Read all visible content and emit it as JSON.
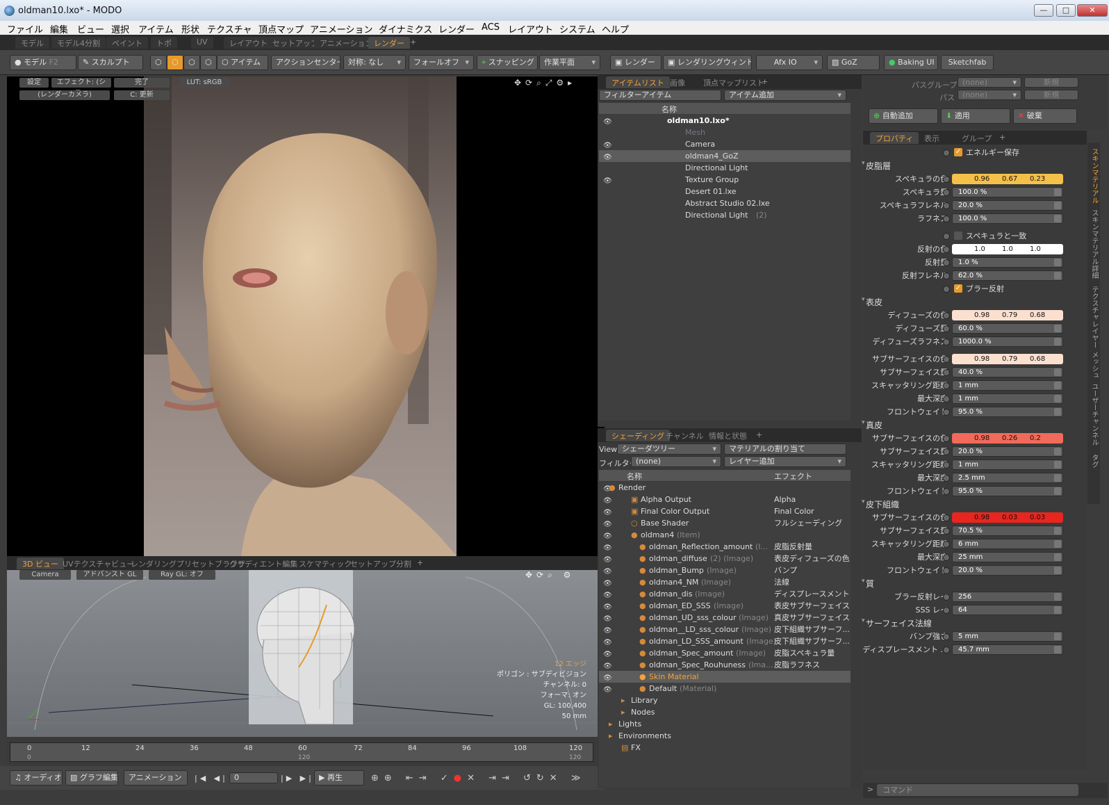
{
  "window": {
    "title": "oldman10.lxo* - MODO"
  },
  "menu": [
    "ファイル",
    "編集",
    "ビュー",
    "選択",
    "アイテム",
    "形状",
    "テクスチャ",
    "頂点マップ",
    "アニメーション",
    "ダイナミクス",
    "レンダー",
    "ACS",
    "レイアウト",
    "システム",
    "ヘルプ"
  ],
  "layout_tabs": [
    "モデル",
    "モデル4分割",
    "ペイント",
    "トポ",
    "UV",
    "レイアウト",
    "セットアップ",
    "アニメーション",
    "レンダー"
  ],
  "toolbar": {
    "model": "モデル",
    "f2": "F2",
    "sculpt": "スカルプト",
    "item": "アイテム",
    "action_center": "アクションセンター",
    "symmetry": "対称: なし",
    "falloff": "フォールオフ",
    "snapping": "スナッピング",
    "work_plane": "作業平面",
    "render": "レンダー",
    "render_window": "レンダリングウィンドウ",
    "afx": "Afx IO",
    "goz": "GoZ",
    "baking": "Baking UI",
    "sketchfab": "Sketchfab"
  },
  "viewport": {
    "settings": "設定",
    "effect": "エフェクト: (シェ...",
    "done": "完了",
    "lut": "LUT: sRGB",
    "camera": "(レンダーカメラ)",
    "update": "C: 更新"
  },
  "bottom_tabs": [
    "3D ビュー",
    "UVテクスチャビュー",
    "レンダリングプリセットブラウザ",
    "グラディエント編集",
    "スケマティック",
    "セットアップ分割"
  ],
  "gl": {
    "camera": "Camera",
    "advanced": "アドバンスト GL",
    "raygl": "Ray GL: オフ",
    "info": [
      "12 エッジ",
      "ポリゴン : サブディビジョン",
      "チャンネル: 0",
      "フォーマ: オン",
      "GL: 100,400",
      "50 mm"
    ]
  },
  "timeline": {
    "ticks": [
      "0",
      "12",
      "24",
      "36",
      "48",
      "60",
      "72",
      "84",
      "96",
      "108",
      "120"
    ],
    "start": "0",
    "mid": "120",
    "end": "120"
  },
  "transport": {
    "audio": "オーディオ",
    "graph": "グラフ編集",
    "animation": "アニメーション",
    "frame": "0",
    "play": "再生"
  },
  "items_panel": {
    "tabs": [
      "アイテムリスト",
      "画像",
      "頂点マップリスト"
    ],
    "filter": "フィルターアイテム",
    "add": "アイテム追加",
    "col_name": "名称",
    "rows": [
      {
        "label": "oldman10.lxo*",
        "sub": ""
      },
      {
        "label": "Mesh",
        "sub": ""
      },
      {
        "label": "Camera",
        "sub": ""
      },
      {
        "label": "oldman4_GoZ",
        "sub": ""
      },
      {
        "label": "Directional Light",
        "sub": ""
      },
      {
        "label": "Texture Group",
        "sub": ""
      },
      {
        "label": "Desert 01.lxe",
        "sub": ""
      },
      {
        "label": "Abstract Studio 02.lxe",
        "sub": ""
      },
      {
        "label": "Directional Light",
        "sub": "(2)"
      }
    ]
  },
  "shading_panel": {
    "tabs": [
      "シェーディング",
      "チャンネル",
      "情報と状態"
    ],
    "view_label": "View",
    "view_value": "シェーダツリー",
    "material_assign": "マテリアルの割り当て",
    "filter_label": "フィルター",
    "filter_value": "(none)",
    "add_layer": "レイヤー追加",
    "col_name": "名称",
    "col_effect": "エフェクト",
    "rows": [
      {
        "label": "Render",
        "sub": "",
        "effect": ""
      },
      {
        "label": "Alpha Output",
        "sub": "",
        "effect": "Alpha"
      },
      {
        "label": "Final Color Output",
        "sub": "",
        "effect": "Final Color"
      },
      {
        "label": "Base Shader",
        "sub": "",
        "effect": "フルシェーディング"
      },
      {
        "label": "oldman4",
        "sub": "(Item)",
        "effect": ""
      },
      {
        "label": "oldman_Reflection_amount",
        "sub": "(I...",
        "effect": "皮脂反射量"
      },
      {
        "label": "oldman_diffuse",
        "sub": "(2) (Image)",
        "effect": "表皮ディフューズの色"
      },
      {
        "label": "oldman_Bump",
        "sub": "(Image)",
        "effect": "バンプ"
      },
      {
        "label": "oldman4_NM",
        "sub": "(Image)",
        "effect": "法線"
      },
      {
        "label": "oldman_dis",
        "sub": "(Image)",
        "effect": "ディスプレースメント"
      },
      {
        "label": "oldman_ED_SSS",
        "sub": "(Image)",
        "effect": "表皮サブサーフェイス..."
      },
      {
        "label": "oldman_UD_sss_colour",
        "sub": "(Image)",
        "effect": "真皮サブサーフェイス..."
      },
      {
        "label": "oldman__LD_sss_colour",
        "sub": "(Image)",
        "effect": "皮下組織サブサーフ..."
      },
      {
        "label": "oldman_LD_SSS_amount",
        "sub": "(Image)",
        "effect": "皮下組織サブサーフ..."
      },
      {
        "label": "oldman_Spec_amount",
        "sub": "(Image)",
        "effect": "皮脂スペキュラ量"
      },
      {
        "label": "oldman_Spec_Rouhuness",
        "sub": "(Ima...",
        "effect": "皮脂ラフネス"
      },
      {
        "label": "Skin Material",
        "sub": "",
        "effect": ""
      },
      {
        "label": "Default",
        "sub": "(Material)",
        "effect": ""
      },
      {
        "label": "Library",
        "sub": "",
        "effect": ""
      },
      {
        "label": "Nodes",
        "sub": "",
        "effect": ""
      },
      {
        "label": "Lights",
        "sub": "",
        "effect": ""
      },
      {
        "label": "Environments",
        "sub": "",
        "effect": ""
      },
      {
        "label": "FX",
        "sub": "",
        "effect": ""
      }
    ]
  },
  "pass_panel": {
    "pass_group": "パスグループ",
    "pass": "パス",
    "none1": "(none)",
    "none2": "(none)",
    "new1": "新規",
    "new2": "新規",
    "auto_add": "自動追加",
    "apply": "適用",
    "discard": "破棄"
  },
  "props": {
    "tabs": [
      "プロパティ",
      "表示",
      "グループ"
    ],
    "energy": "エネルギー保存",
    "sections": {
      "sebum": "皮脂層",
      "epidermis": "表皮",
      "dermis": "真皮",
      "subcut": "皮下組織",
      "quality": "質",
      "surface": "サーフェイス法線"
    },
    "spec_color": {
      "label": "スペキュラの色",
      "v": [
        "0.96",
        "0.67",
        "0.23"
      ]
    },
    "spec_amt": {
      "label": "スペキュラ量",
      "v": "100.0 %"
    },
    "spec_fres": {
      "label": "スペキュラフレネル",
      "v": "20.0 %"
    },
    "rough": {
      "label": "ラフネス",
      "v": "100.0 %"
    },
    "match_spec": "スペキュラと一致",
    "refl_color": {
      "label": "反射の色",
      "v": [
        "1.0",
        "1.0",
        "1.0"
      ]
    },
    "refl_amt": {
      "label": "反射量",
      "v": "1.0 %"
    },
    "refl_fres": {
      "label": "反射フレネル",
      "v": "62.0 %"
    },
    "blur_refl": "ブラー反射",
    "diff_color": {
      "label": "ディフューズの色",
      "v": [
        "0.98",
        "0.79",
        "0.68"
      ]
    },
    "diff_amt": {
      "label": "ディフューズ量",
      "v": "60.0 %"
    },
    "diff_rough": {
      "label": "ディフューズラフネス",
      "v": "1000.0 %"
    },
    "e_sss_color": {
      "label": "サブサーフェイスの色",
      "v": [
        "0.98",
        "0.79",
        "0.68"
      ]
    },
    "e_sss_amt": {
      "label": "サブサーフェイス量",
      "v": "40.0 %"
    },
    "e_scatter": {
      "label": "スキャッタリング距離",
      "v": "1 mm"
    },
    "e_depth": {
      "label": "最大深度",
      "v": "1 mm"
    },
    "e_front": {
      "label": "フロントウェイト",
      "v": "95.0 %"
    },
    "d_sss_color": {
      "label": "サブサーフェイスの色",
      "v": [
        "0.98",
        "0.26",
        "0.2"
      ]
    },
    "d_sss_amt": {
      "label": "サブサーフェイス量",
      "v": "20.0 %"
    },
    "d_scatter": {
      "label": "スキャッタリング距離",
      "v": "1 mm"
    },
    "d_depth": {
      "label": "最大深度",
      "v": "2.5 mm"
    },
    "d_front": {
      "label": "フロントウェイト",
      "v": "95.0 %"
    },
    "s_sss_color": {
      "label": "サブサーフェイスの色",
      "v": [
        "0.98",
        "0.03",
        "0.03"
      ]
    },
    "s_sss_amt": {
      "label": "サブサーフェイス量",
      "v": "70.5 %"
    },
    "s_scatter": {
      "label": "スキャッタリング距離",
      "v": "6 mm"
    },
    "s_depth": {
      "label": "最大深度",
      "v": "25 mm"
    },
    "s_front": {
      "label": "フロントウェイト",
      "v": "20.0 %"
    },
    "blur_rays": {
      "label": "ブラー反射レイ",
      "v": "256"
    },
    "sss_rays": {
      "label": "SSS レイ",
      "v": "64"
    },
    "bump": {
      "label": "バンプ強さ",
      "v": "5 mm"
    },
    "disp": {
      "label": "ディスプレースメント ...",
      "v": "45.7 mm"
    }
  },
  "side_tabs": [
    "スキンマテリアル",
    "スキンマテリアル詳細",
    "テクスチャレイヤー",
    "メッシュ",
    "ユーザーチャンネル",
    "タグ"
  ],
  "command": "コマンド",
  "colors": {
    "accent": "#f2a33a",
    "spec": "#f5c04a",
    "diffuse": "#fbe0d0",
    "dermis": "#f26a5a",
    "subcut": "#e8261f"
  }
}
